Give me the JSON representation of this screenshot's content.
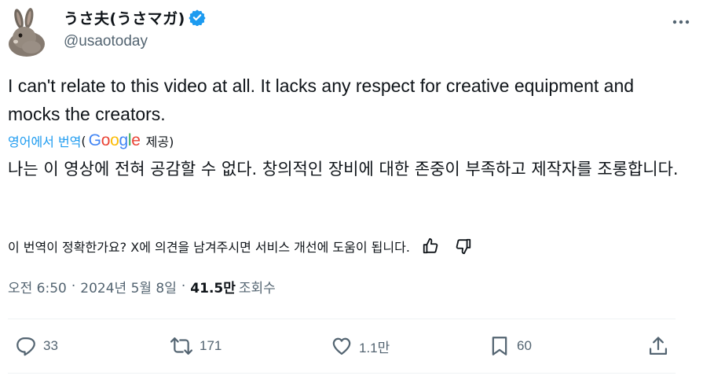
{
  "author": {
    "display_name": "うさ夫(うさマガ)",
    "handle": "@usaotoday",
    "verified": true
  },
  "tweet": {
    "text": "I can't relate to this video at all. It lacks any respect for creative equipment and mocks the creators."
  },
  "translation": {
    "link_label": "영어에서 번역",
    "open_paren": "(",
    "provider": "Google",
    "provided_by": "제공)",
    "text": "나는 이 영상에 전혀 공감할 수 없다. 창의적인 장비에 대한 존중이 부족하고 제작자를 조롱합니다.",
    "feedback_prompt": "이 번역이 정확한가요? X에 의견을 남겨주시면 서비스 개선에 도움이 됩니다."
  },
  "meta": {
    "time": "오전 6:50",
    "separator": "·",
    "date": "2024년 5월 8일",
    "separator2": "·",
    "views_count": "41.5만",
    "views_label": "조회수"
  },
  "actions": {
    "replies": "33",
    "reposts": "171",
    "likes": "1.1만",
    "bookmarks": "60"
  },
  "colors": {
    "accent": "#1d9bf0",
    "text": "#0f1419",
    "secondary": "#536471"
  },
  "icons": [
    "avatar-rabbit",
    "verified-badge-icon",
    "more-icon",
    "thumbs-up-icon",
    "thumbs-down-icon",
    "reply-icon",
    "retweet-icon",
    "like-icon",
    "bookmark-icon",
    "share-icon"
  ]
}
